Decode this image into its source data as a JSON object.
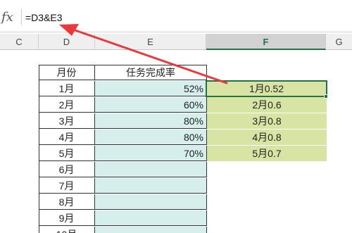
{
  "formula_bar": {
    "fx_label": "fx",
    "formula": "=D3&E3"
  },
  "column_headers": [
    "C",
    "D",
    "E",
    "F",
    "G"
  ],
  "selected_column": "F",
  "table": {
    "headers": {
      "month": "月份",
      "rate": "任务完成率"
    },
    "rows": [
      {
        "month": "1月",
        "rate": "52%",
        "result": "1月0.52"
      },
      {
        "month": "2月",
        "rate": "60%",
        "result": "2月0.6"
      },
      {
        "month": "3月",
        "rate": "80%",
        "result": "3月0.8"
      },
      {
        "month": "4月",
        "rate": "80%",
        "result": "4月0.8"
      },
      {
        "month": "5月",
        "rate": "70%",
        "result": "5月0.7"
      },
      {
        "month": "6月",
        "rate": "",
        "result": ""
      },
      {
        "month": "7月",
        "rate": "",
        "result": ""
      },
      {
        "month": "8月",
        "rate": "",
        "result": ""
      },
      {
        "month": "9月",
        "rate": "",
        "result": ""
      },
      {
        "month": "10月",
        "rate": "",
        "result": ""
      }
    ]
  },
  "colors": {
    "rate_fill": "#d6efed",
    "result_fill": "#d8e4a3",
    "selection": "#217346",
    "arrow": "#e8393d"
  },
  "annotation_icon": "red-arrow-icon"
}
